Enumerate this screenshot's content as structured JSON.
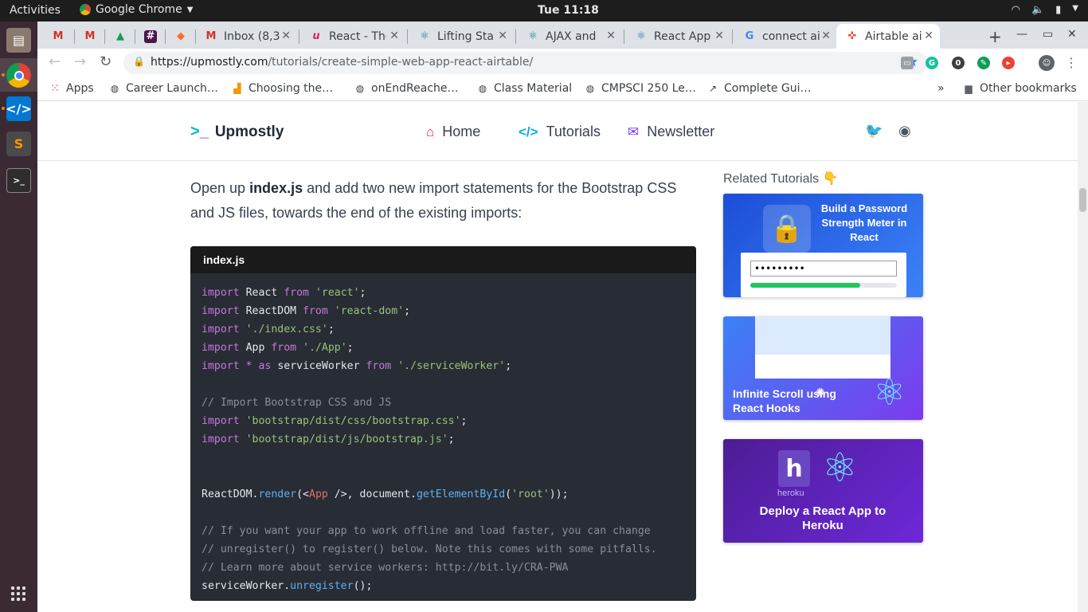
{
  "system": {
    "activities": "Activities",
    "app_name": "Google Chrome",
    "clock": "Tue 11:18"
  },
  "tabs": [
    {
      "title": "",
      "favicon": "gmail-icon",
      "color": "#d93025"
    },
    {
      "title": "",
      "favicon": "gmail-icon",
      "color": "#d93025"
    },
    {
      "title": "",
      "favicon": "drive-icon",
      "color": "#1a73e8"
    },
    {
      "title": "",
      "favicon": "slack-icon",
      "color": "#4a154b"
    },
    {
      "title": "",
      "favicon": "gitlab-icon",
      "color": "#fc6d26"
    },
    {
      "title": "Inbox (8,3",
      "favicon": "gmail-icon",
      "color": "#d93025"
    },
    {
      "title": "React - The",
      "favicon": "react-icon",
      "color": "#e0234e"
    },
    {
      "title": "Lifting Sta",
      "favicon": "react-icon",
      "color": "#0a7ea4"
    },
    {
      "title": "AJAX and",
      "favicon": "react-icon",
      "color": "#0a7ea4"
    },
    {
      "title": "React App",
      "favicon": "react-icon",
      "color": "#0a7ea4"
    },
    {
      "title": "connect ai",
      "favicon": "google-icon",
      "color": "#4285f4"
    },
    {
      "title": "Airtable ai",
      "favicon": "airtable-icon",
      "color": "#e74c3c",
      "active": true
    }
  ],
  "toolbar": {
    "url_host": "https://upmostly.com",
    "url_path": "/tutorials/create-simple-web-app-react-airtable/",
    "ext_badge": "0"
  },
  "bookmarks": [
    {
      "label": "Apps",
      "icon": "apps-grid-icon"
    },
    {
      "label": "Career Launch…",
      "icon": "globe-icon"
    },
    {
      "label": "Choosing the…",
      "icon": "chart-icon"
    },
    {
      "label": "onEndReache…",
      "icon": "globe-icon"
    },
    {
      "label": "Class Material",
      "icon": "globe-icon"
    },
    {
      "label": "CMPSCI 250 Le…",
      "icon": "globe-icon"
    },
    {
      "label": "Complete Gui…",
      "icon": "trend-icon"
    }
  ],
  "bookmarks_more": "»",
  "other_bookmarks": "Other bookmarks",
  "site": {
    "logo": "Upmostly",
    "nav": [
      "Home",
      "Tutorials",
      "Newsletter"
    ]
  },
  "article": {
    "intro_1": "Open up ",
    "intro_bold": "index.js",
    "intro_2": " and add two new import statements for the Bootstrap CSS and JS files, towards the end of the existing imports:",
    "code_filename": "index.js"
  },
  "sidebar": {
    "title": "Related Tutorials 👇",
    "cards": [
      {
        "title": "Build a Password Strength Meter in React",
        "password": "•••••••••"
      },
      {
        "title": "Infinite Scroll using React Hooks"
      },
      {
        "title": "Deploy a React App to Heroku",
        "subtitle": "heroku"
      }
    ]
  }
}
